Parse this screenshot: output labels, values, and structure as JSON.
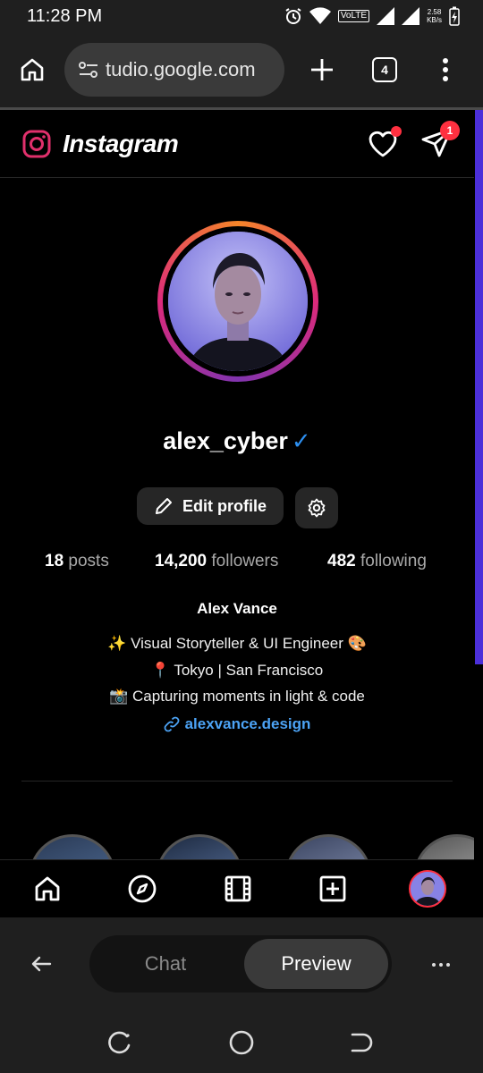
{
  "status_bar": {
    "time": "11:28 PM",
    "network_label": "VoLTE",
    "speed_value": "2.58",
    "speed_unit": "KB/s"
  },
  "browser": {
    "url": "tudio.google.com",
    "tab_count": "4"
  },
  "instagram": {
    "wordmark": "Instagram",
    "dm_badge": "1",
    "profile": {
      "username": "alex_cyber",
      "verified_mark": "✓",
      "edit_label": "Edit profile",
      "stats": {
        "posts_value": "18",
        "posts_label": "posts",
        "followers_value": "14,200",
        "followers_label": "followers",
        "following_value": "482",
        "following_label": "following"
      },
      "bio": {
        "name": "Alex Vance",
        "line1": "✨ Visual Storyteller & UI Engineer 🎨",
        "line2": "📍 Tokyo | San Francisco",
        "line3": "📸 Capturing moments in light & code",
        "link": "alexvance.design"
      }
    }
  },
  "studio": {
    "chat_label": "Chat",
    "preview_label": "Preview"
  },
  "colors": {
    "accent_blue": "#4ca3f5",
    "verified_blue": "#2d8ff0",
    "notification_red": "#ff3040",
    "scrollbar_purple": "#4b2fd9"
  }
}
